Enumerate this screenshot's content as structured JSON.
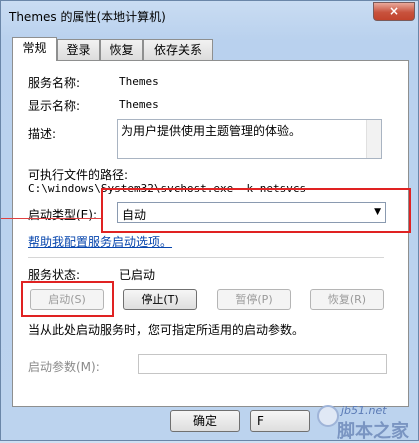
{
  "window": {
    "title": "Themes 的属性(本地计算机)",
    "close_label": "×"
  },
  "tabs": [
    {
      "label": "常规",
      "active": true
    },
    {
      "label": "登录",
      "active": false
    },
    {
      "label": "恢复",
      "active": false
    },
    {
      "label": "依存关系",
      "active": false
    }
  ],
  "general": {
    "service_name_label": "服务名称:",
    "service_name_value": "Themes",
    "display_name_label": "显示名称:",
    "display_name_value": "Themes",
    "description_label": "描述:",
    "description_value": "为用户提供使用主题管理的体验。",
    "exe_path_label": "可执行文件的路径:",
    "exe_path_value": "C:\\windows\\System32\\svchost.exe -k netsvcs",
    "startup_type_label": "启动类型(E):",
    "startup_type_value": "自动",
    "help_link": "帮助我配置服务启动选项。",
    "service_status_label": "服务状态:",
    "service_status_value": "已启动",
    "buttons": {
      "start": "启动(S)",
      "stop": "停止(T)",
      "pause": "暂停(P)",
      "resume": "恢复(R)"
    },
    "hint_text": "当从此处启动服务时，您可指定所适用的启动参数。",
    "start_params_label": "启动参数(M):",
    "start_params_value": ""
  },
  "footer": {
    "ok": "确定",
    "cancel_partial": "F"
  },
  "watermark": {
    "site": "jb51.net",
    "name": "脚本之家"
  },
  "colors": {
    "highlight": "#e02222",
    "link": "#0645ad"
  }
}
